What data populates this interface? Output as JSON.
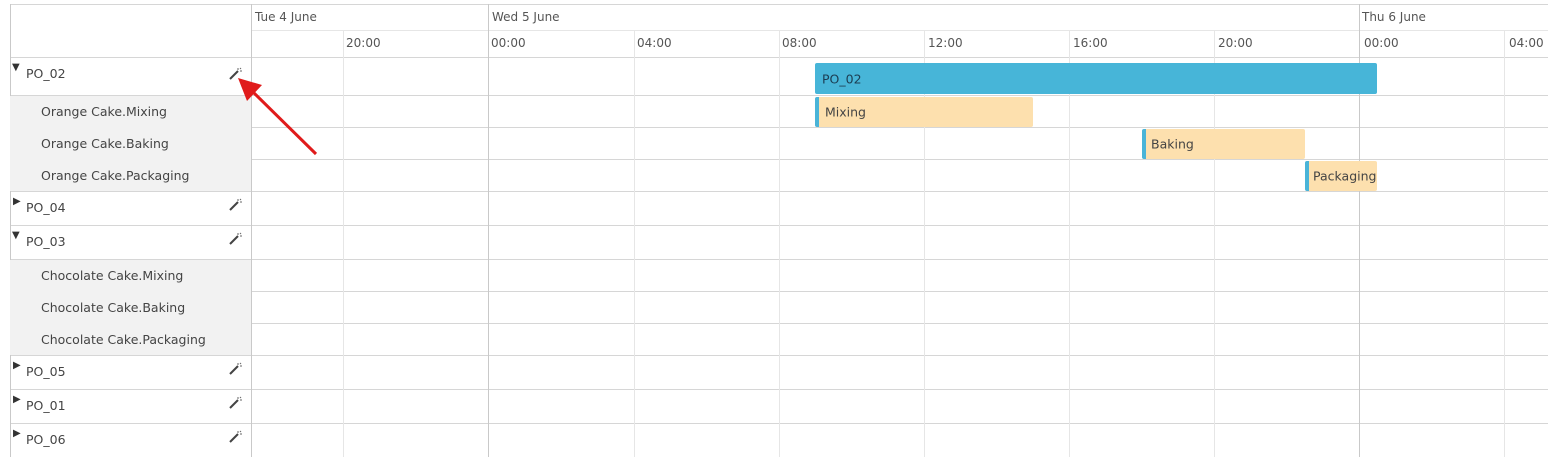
{
  "header": {
    "days": [
      {
        "label": "Tue 4 June"
      },
      {
        "label": "Wed 5 June"
      },
      {
        "label": "Thu 6 June"
      }
    ],
    "times": [
      "20:00",
      "00:00",
      "04:00",
      "08:00",
      "12:00",
      "16:00",
      "20:00",
      "00:00",
      "04:00"
    ]
  },
  "rows": [
    {
      "label": "PO_02",
      "type": "order",
      "expanded": true,
      "icon": "magic-wand-icon"
    },
    {
      "label": "Orange Cake.Mixing",
      "type": "operation"
    },
    {
      "label": "Orange Cake.Baking",
      "type": "operation"
    },
    {
      "label": "Orange Cake.Packaging",
      "type": "operation"
    },
    {
      "label": "PO_04",
      "type": "order",
      "expanded": false,
      "icon": "magic-wand-icon"
    },
    {
      "label": "PO_03",
      "type": "order",
      "expanded": true,
      "icon": "magic-wand-icon"
    },
    {
      "label": "Chocolate Cake.Mixing",
      "type": "operation"
    },
    {
      "label": "Chocolate Cake.Baking",
      "type": "operation"
    },
    {
      "label": "Chocolate Cake.Packaging",
      "type": "operation"
    },
    {
      "label": "PO_05",
      "type": "order",
      "expanded": false,
      "icon": "magic-wand-icon"
    },
    {
      "label": "PO_01",
      "type": "order",
      "expanded": false,
      "icon": "magic-wand-icon"
    },
    {
      "label": "PO_06",
      "type": "order",
      "expanded": false,
      "icon": "magic-wand-icon"
    }
  ],
  "bars": [
    {
      "label": "PO_02",
      "kind": "summary",
      "start": "Wed 5 June 09:00",
      "end": "Thu 6 June 00:30"
    },
    {
      "label": "Mixing",
      "kind": "task",
      "start": "Wed 5 June 09:00",
      "end": "Wed 5 June 15:00"
    },
    {
      "label": "Baking",
      "kind": "task",
      "start": "Wed 5 June 18:00",
      "end": "Wed 5 June 22:30"
    },
    {
      "label": "Packaging",
      "kind": "task",
      "start": "Wed 5 June 22:30",
      "end": "Thu 6 June 00:30"
    }
  ],
  "colors": {
    "summary_bar": "#47b5d8",
    "task_bar": "#fde0ae",
    "task_edge": "#4ab4d8",
    "subrow_bg": "#f2f2f2",
    "grid_major": "#c9c9c9",
    "grid_minor": "#e6e6e6",
    "annotation_arrow": "#e01b1b"
  },
  "annotation": {
    "type": "arrow",
    "points_to": "magic-wand-icon on PO_02"
  }
}
